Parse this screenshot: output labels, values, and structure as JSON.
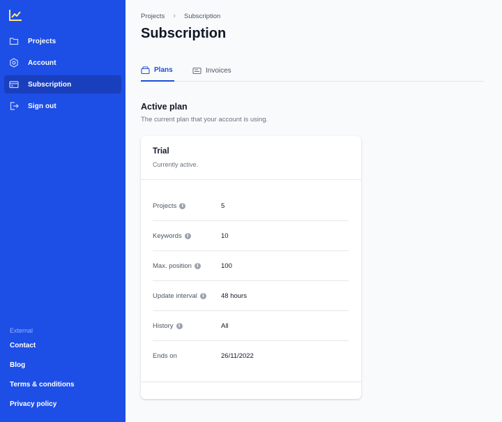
{
  "sidebar": {
    "items": [
      {
        "label": "Projects",
        "icon": "folder-icon"
      },
      {
        "label": "Account",
        "icon": "gear-icon"
      },
      {
        "label": "Subscription",
        "icon": "credit-card-icon",
        "active": true
      },
      {
        "label": "Sign out",
        "icon": "sign-out-icon"
      }
    ],
    "external_heading": "External",
    "external_links": [
      "Contact",
      "Blog",
      "Terms & conditions",
      "Privacy policy"
    ]
  },
  "breadcrumb": [
    "Projects",
    "Subscription"
  ],
  "page_title": "Subscription",
  "tabs": [
    {
      "label": "Plans",
      "icon": "box-icon",
      "active": true
    },
    {
      "label": "Invoices",
      "icon": "receipt-icon",
      "active": false
    }
  ],
  "active_plan": {
    "title": "Active plan",
    "description": "The current plan that your account is using.",
    "plan_name": "Trial",
    "plan_status": "Currently active.",
    "rows": [
      {
        "label": "Projects",
        "value": "5"
      },
      {
        "label": "Keywords",
        "value": "10"
      },
      {
        "label": "Max. position",
        "value": "100"
      },
      {
        "label": "Update interval",
        "value": "48 hours"
      },
      {
        "label": "History",
        "value": "All"
      },
      {
        "label": "Ends on",
        "value": "26/11/2022"
      }
    ]
  },
  "colors": {
    "sidebar_bg": "#1d4ee6",
    "sidebar_active": "#1a3fbd",
    "accent": "#1d4ed8"
  }
}
